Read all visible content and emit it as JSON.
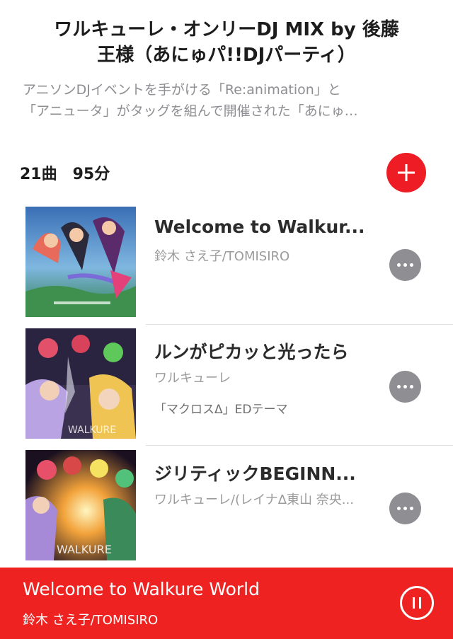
{
  "playlist": {
    "title_line1": "ワルキューレ・オンリーDJ MIX by 後藤",
    "title_line2": "王様（あにゅパ!!DJパーティ）",
    "description_line1": "アニソンDJイベントを手がける「Re:animation」と",
    "description_line2": "「アニュータ」がタッグを組んで開催された「あにゅ…",
    "track_count": "21曲",
    "duration": "95分"
  },
  "tracks": [
    {
      "title": "Welcome to Walkur...",
      "artist": "鈴木 さえ子/TOMISIRO",
      "note": ""
    },
    {
      "title": "ルンがピカッと光ったら",
      "artist": "ワルキューレ",
      "note": "「マクロスΔ」EDテーマ"
    },
    {
      "title": "ジリティックBEGINN...",
      "artist": "ワルキューレ/(レイナΔ東山 奈央...",
      "note": ""
    }
  ],
  "now_playing": {
    "title": "Welcome to Walkure World",
    "artist": "鈴木 さえ子/TOMISIRO"
  },
  "colors": {
    "accent": "#ee2220",
    "more_button": "#8e8e93"
  },
  "icons": {
    "add": "plus-icon",
    "more": "ellipsis-icon",
    "pause": "pause-icon"
  }
}
